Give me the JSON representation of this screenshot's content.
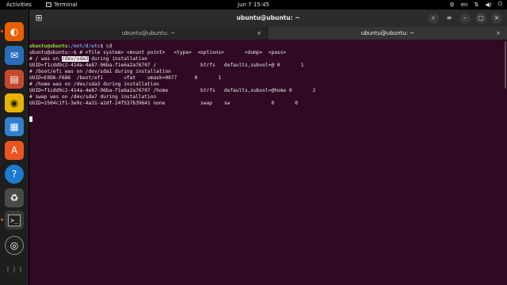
{
  "topbar": {
    "activities": "Activities",
    "app_name": "Terminal",
    "clock": "Jun 7  15:45",
    "lang": "en"
  },
  "window": {
    "title": "ubuntu@ubuntu: ~",
    "tabs": [
      {
        "label": "ubuntu@ubuntu: ~"
      },
      {
        "label": "ubuntu@ubuntu: ~"
      }
    ]
  },
  "terminal": {
    "prompt_user": "ubuntu@ubuntu",
    "prompt_path": ":/mnt/d/etc",
    "prompt_tail": "$ cd",
    "line2": "ubuntu@ubuntu:~$ # <file system> <mount point>   <type>  <options>       <dump>  <pass>",
    "line3_a": "# / was on ",
    "line3_hl": "/dev/sda3",
    "line3_b": " during installation",
    "line4": "UUID=f1cdd9c2-414a-4e87-96ba-f1e6a2a76707 /               btrfs   defaults,subvol=@ 0       1",
    "line5": "# /boot/efi was on /dev/sda1 during installation",
    "line6": "UUID=E0D6-F686  /boot/efi       vfat    umask=0077      0       1",
    "line7": "# /home was on /dev/sda3 during installation",
    "line8": "UUID=f1cdd9c2-414a-4e87-96ba-f1e6a2a76707 /home           btrfs   defaults,subvol=@home 0       2",
    "line9": "# swap was on /dev/sda7 during installation",
    "line10": "UUID=2504c1f1-3e9c-4a31-a2df-24f537b39641 none            swap    sw              0       0"
  },
  "dock": {
    "items": [
      {
        "name": "firefox",
        "glyph": "🦊"
      },
      {
        "name": "thunderbird",
        "glyph": "✉"
      },
      {
        "name": "files",
        "glyph": "▤"
      },
      {
        "name": "rhythmbox",
        "glyph": "◉"
      },
      {
        "name": "writer",
        "glyph": "▦"
      },
      {
        "name": "software",
        "glyph": "A"
      },
      {
        "name": "help",
        "glyph": "?"
      },
      {
        "name": "trash",
        "glyph": "♻"
      },
      {
        "name": "terminal",
        "glyph": ">_"
      },
      {
        "name": "obs",
        "glyph": "◎"
      },
      {
        "name": "apps",
        "glyph": "⋮⋮"
      }
    ]
  },
  "colors": {
    "terminal_bg": "#300a24",
    "accent": "#e95420"
  }
}
